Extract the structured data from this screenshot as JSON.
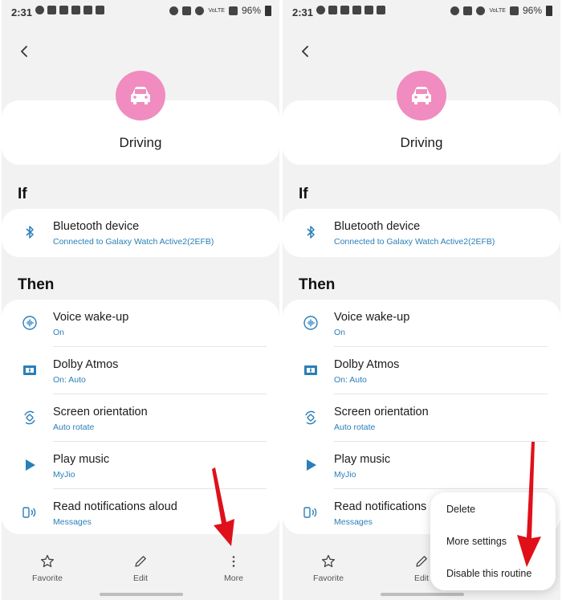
{
  "status_bar": {
    "time": "2:31",
    "battery": "96%",
    "network": "VoLTE"
  },
  "routine": {
    "name": "Driving",
    "icon": "car-icon",
    "icon_color": "#f08cbf"
  },
  "sections": {
    "if_label": "If",
    "then_label": "Then"
  },
  "conditions": [
    {
      "title": "Bluetooth device",
      "subtitle": "Connected to Galaxy Watch Active2(2EFB)",
      "icon": "bluetooth-icon"
    }
  ],
  "actions": [
    {
      "title": "Voice wake-up",
      "subtitle": "On",
      "icon": "voice-wakeup-icon"
    },
    {
      "title": "Dolby Atmos",
      "subtitle": "On: Auto",
      "icon": "dolby-icon"
    },
    {
      "title": "Screen orientation",
      "subtitle": "Auto rotate",
      "icon": "rotate-icon"
    },
    {
      "title": "Play music",
      "subtitle": "MyJio",
      "icon": "play-icon"
    },
    {
      "title": "Read notifications aloud",
      "subtitle": "Messages",
      "icon": "read-aloud-icon"
    }
  ],
  "bottom_nav": {
    "favorite": "Favorite",
    "edit": "Edit",
    "more": "More"
  },
  "more_menu": {
    "delete": "Delete",
    "more_settings": "More settings",
    "disable": "Disable this routine"
  },
  "colors": {
    "accent_text": "#2a7fb8",
    "background": "#f2f2f2",
    "annotation_arrow": "#e0101a"
  }
}
